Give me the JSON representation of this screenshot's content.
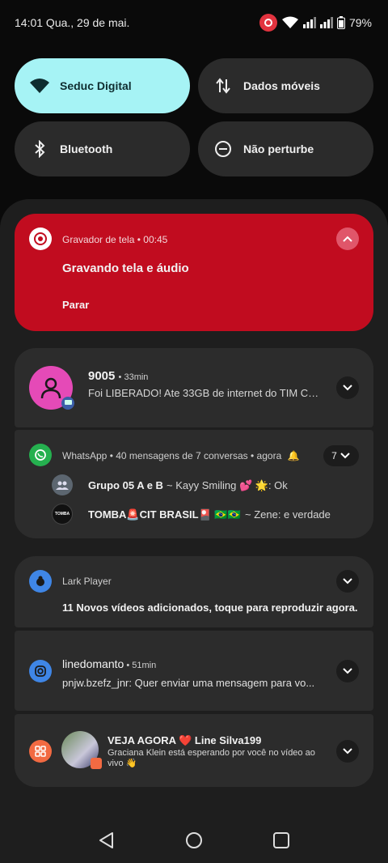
{
  "status_bar": {
    "time_date": "14:01 Qua., 29 de mai.",
    "battery": "79%"
  },
  "quick_settings": {
    "wifi": "Seduc Digital",
    "mobile_data": "Dados móveis",
    "bluetooth": "Bluetooth",
    "dnd": "Não perturbe"
  },
  "screen_recorder": {
    "app": "Gravador de tela",
    "time": "00:45",
    "title": "Gravando tela e áudio",
    "action": "Parar"
  },
  "sms": {
    "sender": "9005",
    "time": "33min",
    "message": "Foi LIBERADO! Ate 33GB de internet do TIM Co..."
  },
  "whatsapp": {
    "app": "WhatsApp",
    "summary": "40 mensagens de 7 conversas",
    "time": "agora",
    "count": "7",
    "conversations": [
      {
        "name": "Grupo 05 A e B",
        "preview": "~ Kayy Smiling 💕 🌟: Ok"
      },
      {
        "name": "TOMBA🚨CIT BRASIL🎴 🇧🇷🇧🇷",
        "preview": "~ Zene: e verdade",
        "avatar_text": "TOMBA"
      }
    ]
  },
  "lark": {
    "app": "Lark Player",
    "message": "11 Novos vídeos adicionados, toque para reproduzir agora."
  },
  "instagram": {
    "sender": "linedomanto",
    "time": "51min",
    "message": "pnjw.bzefz_jnr:  Quer enviar uma mensagem para vo..."
  },
  "live": {
    "title": "VEJA AGORA ❤️ Line Silva199",
    "message": "Graciana Klein está esperando por você no vídeo ao vivo",
    "emoji": "👋"
  },
  "colors": {
    "accent_tile": "#a6f3f5",
    "recorder_red": "#c10c1f",
    "whatsapp_green": "#25b04f"
  }
}
